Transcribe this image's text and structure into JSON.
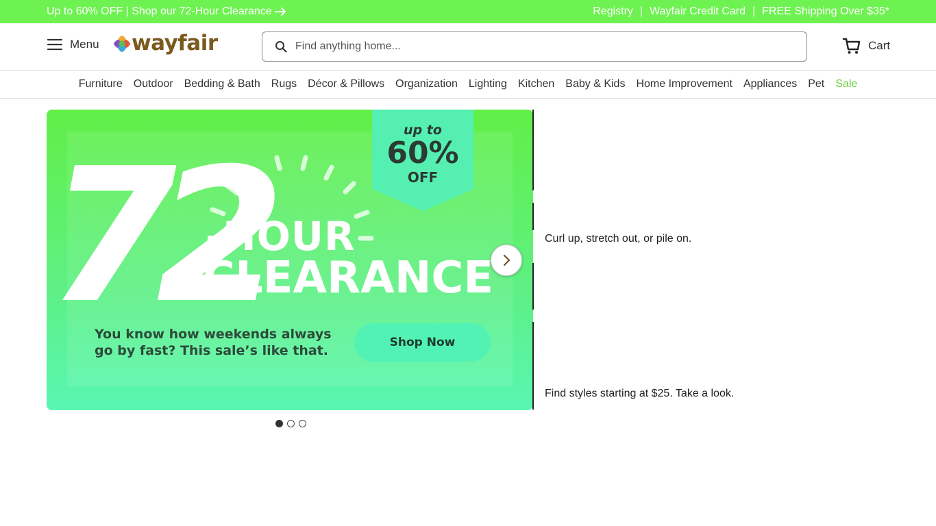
{
  "promo": {
    "left_text": "Up to 60% OFF | Shop our 72-Hour Clearance",
    "registry": "Registry",
    "credit_card": "Wayfair Credit Card",
    "shipping": "FREE Shipping Over $35*",
    "separator": "|"
  },
  "header": {
    "menu_label": "Menu",
    "logo_text": "wayfair",
    "search_placeholder": "Find anything home...",
    "cart_label": "Cart"
  },
  "categories": [
    "Furniture",
    "Outdoor",
    "Bedding & Bath",
    "Rugs",
    "Décor & Pillows",
    "Organization",
    "Lighting",
    "Kitchen",
    "Baby & Kids",
    "Home Improvement",
    "Appliances",
    "Pet",
    "Sale"
  ],
  "hero": {
    "number": "72",
    "hour": "-HOUR",
    "clearance": "CLEARANCE",
    "badge_upto": "up to",
    "badge_percent": "60%",
    "badge_off": "OFF",
    "tagline": "You know how weekends always go by fast? This sale’s like that.",
    "cta": "Shop Now",
    "slide_count": 3,
    "active_slide": 1
  },
  "side_cards": {
    "first": "Curl up, stretch out, or pile on.",
    "second": "Find styles starting at $25. Take a look."
  },
  "colors": {
    "promo_bg": "#6ef251",
    "sale_text": "#6bcf3c",
    "logo_text": "#7a5a1e",
    "hero_cta": "#52f2b5"
  },
  "icons": {
    "promo_arrow": "arrow-right-icon",
    "menu": "hamburger-icon",
    "search": "search-icon",
    "cart": "cart-icon",
    "carousel_next": "chevron-right-icon"
  }
}
